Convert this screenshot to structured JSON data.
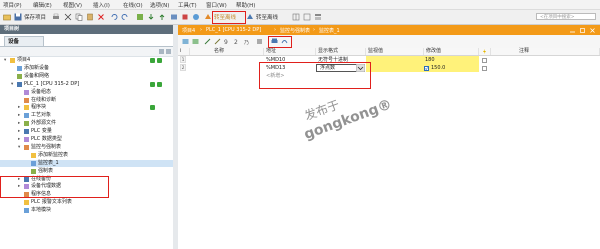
{
  "menubar": {
    "items": [
      "项目(P)",
      "编辑(E)",
      "视图(V)",
      "插入(I)",
      "在线(O)",
      "选项(N)",
      "工具(T)",
      "窗口(W)",
      "帮助(H)"
    ]
  },
  "toolbar": {
    "save_label": "保存项目",
    "go_offline": "转至离线",
    "monitor_all": "转至离线",
    "search_placeholder": "<在项目中搜索>"
  },
  "left_panel": {
    "header": "项目树",
    "tab": "设备",
    "tree": [
      {
        "label": "项目4",
        "level": 0,
        "expanded": true,
        "checks": 2
      },
      {
        "label": "添加新设备",
        "level": 1
      },
      {
        "label": "设备和网络",
        "level": 1
      },
      {
        "label": "PLC_1 [CPU 315-2 DP]",
        "level": 1,
        "expanded": true,
        "checks": 2
      },
      {
        "label": "设备组态",
        "level": 2
      },
      {
        "label": "在线和诊断",
        "level": 2
      },
      {
        "label": "程序块",
        "level": 2,
        "checks": 1
      },
      {
        "label": "工艺对象",
        "level": 2
      },
      {
        "label": "外部源文件",
        "level": 2
      },
      {
        "label": "PLC 变量",
        "level": 2
      },
      {
        "label": "PLC 数据类型",
        "level": 2
      },
      {
        "label": "监控与强制表",
        "level": 2,
        "expanded": true
      },
      {
        "label": "添加新监控表",
        "level": 3
      },
      {
        "label": "监控表_1",
        "level": 3,
        "selected": true
      },
      {
        "label": "强制表",
        "level": 3
      },
      {
        "label": "在线备份",
        "level": 2
      },
      {
        "label": "设备代理数据",
        "level": 2
      },
      {
        "label": "程序信息",
        "level": 2
      },
      {
        "label": "PLC 报警文本列表",
        "level": 2
      },
      {
        "label": "本地模块",
        "level": 2
      }
    ]
  },
  "editor": {
    "breadcrumb": [
      "项目4",
      "PLC_1 [CPU 315-2 DP]",
      "监控与强制表",
      "监控表_1"
    ],
    "columns": [
      "i",
      "名称",
      "地址",
      "显示格式",
      "监视值",
      "修改值",
      "",
      "注释"
    ],
    "rows": [
      {
        "num": "1",
        "address": "%MD10",
        "format": "无符号十进制",
        "monitor": "",
        "modify": "180"
      },
      {
        "num": "2",
        "address": "%MD13",
        "format": "浮点数",
        "monitor": "",
        "modify": "150.0"
      },
      {
        "num": "",
        "address": "<新增>",
        "format": "",
        "monitor": "",
        "modify": ""
      }
    ],
    "accent": "#f39a18",
    "highlight": "#fff27a"
  },
  "watermark": {
    "line1": "发布于",
    "line2": "gongkong®"
  }
}
